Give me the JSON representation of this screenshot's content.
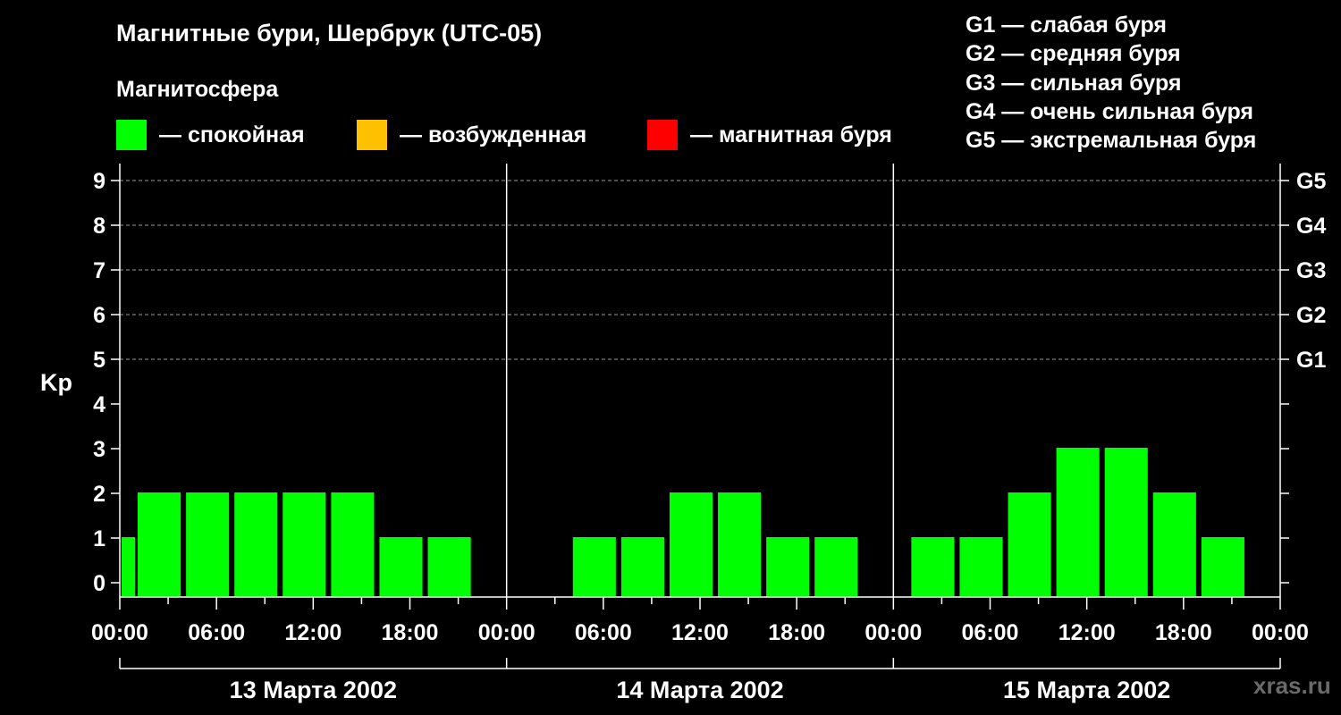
{
  "header": {
    "title": "Магнитные бури, Шербрук (UTC-05)",
    "subtitle": "Магнитосфера"
  },
  "status_legend": [
    {
      "label": "— спокойная",
      "color": "#00ff00"
    },
    {
      "label": "— возбужденная",
      "color": "#ffc000"
    },
    {
      "label": "— магнитная буря",
      "color": "#ff0000"
    }
  ],
  "g_legend": [
    "G1 — слабая буря",
    "G2 — средняя буря",
    "G3 — сильная буря",
    "G4 — очень сильная буря",
    "G5 — экстремальная буря"
  ],
  "watermark": "xras.ru",
  "chart_data": {
    "type": "bar",
    "ylabel": "Kp",
    "ylim": [
      0,
      9
    ],
    "yticks": [
      "0",
      "1",
      "2",
      "3",
      "4",
      "5",
      "6",
      "7",
      "8",
      "9"
    ],
    "right_axis_labels": [
      {
        "kp": 5,
        "label": "G1"
      },
      {
        "kp": 6,
        "label": "G2"
      },
      {
        "kp": 7,
        "label": "G3"
      },
      {
        "kp": 8,
        "label": "G4"
      },
      {
        "kp": 9,
        "label": "G5"
      }
    ],
    "xtick_labels": [
      "00:00",
      "06:00",
      "12:00",
      "18:00",
      "00:00",
      "06:00",
      "12:00",
      "18:00",
      "00:00",
      "06:00",
      "12:00",
      "18:00",
      "00:00"
    ],
    "days": [
      "13 Марта 2002",
      "14 Марта 2002",
      "15 Марта 2002"
    ],
    "grid": "dashed horizontal at Kp 5-9",
    "bar_color": "#00ff00",
    "bars": [
      {
        "day": 0,
        "start_hour": 0,
        "value": 1
      },
      {
        "day": 0,
        "start_hour": 1,
        "value": 2
      },
      {
        "day": 0,
        "start_hour": 4,
        "value": 2
      },
      {
        "day": 0,
        "start_hour": 7,
        "value": 2
      },
      {
        "day": 0,
        "start_hour": 10,
        "value": 2
      },
      {
        "day": 0,
        "start_hour": 13,
        "value": 2
      },
      {
        "day": 0,
        "start_hour": 16,
        "value": 1
      },
      {
        "day": 0,
        "start_hour": 19,
        "value": 1
      },
      {
        "day": 1,
        "start_hour": 4,
        "value": 1
      },
      {
        "day": 1,
        "start_hour": 7,
        "value": 1
      },
      {
        "day": 1,
        "start_hour": 10,
        "value": 2
      },
      {
        "day": 1,
        "start_hour": 13,
        "value": 2
      },
      {
        "day": 1,
        "start_hour": 16,
        "value": 1
      },
      {
        "day": 1,
        "start_hour": 19,
        "value": 1
      },
      {
        "day": 2,
        "start_hour": 1,
        "value": 1
      },
      {
        "day": 2,
        "start_hour": 4,
        "value": 1
      },
      {
        "day": 2,
        "start_hour": 7,
        "value": 2
      },
      {
        "day": 2,
        "start_hour": 10,
        "value": 3
      },
      {
        "day": 2,
        "start_hour": 13,
        "value": 3
      },
      {
        "day": 2,
        "start_hour": 16,
        "value": 2
      },
      {
        "day": 2,
        "start_hour": 19,
        "value": 1
      }
    ]
  }
}
